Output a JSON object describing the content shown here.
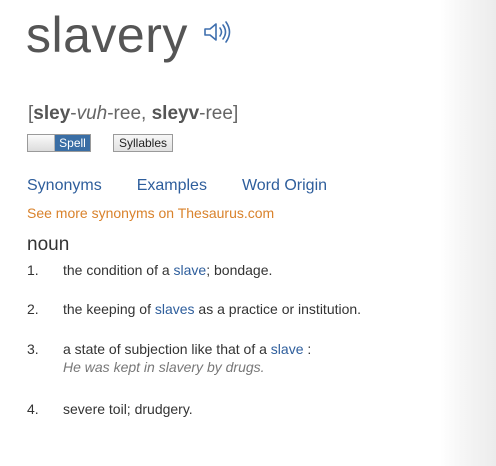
{
  "entry": {
    "headword": "slavery",
    "audio_icon": "speaker-icon",
    "pronunciation": {
      "open_bracket": "[",
      "p1_bold": "sley",
      "p1_dash": "-",
      "p1_italic": "vuh",
      "p1_rest": "-ree, ",
      "p2_bold": "sleyv",
      "p2_rest": "-ree",
      "close_bracket": "]"
    }
  },
  "controls": {
    "spell_label": "Spell",
    "syllables_label": "Syllables"
  },
  "links": {
    "synonyms": "Synonyms",
    "examples": "Examples",
    "word_origin": "Word Origin",
    "thesaurus": "See more synonyms on Thesaurus.com"
  },
  "part_of_speech": "noun",
  "definitions": [
    {
      "number": "1.",
      "before": "the condition of a ",
      "link": "slave",
      "after": "; bondage."
    },
    {
      "number": "2.",
      "before": "the keeping of ",
      "link": "slaves",
      "after": " as a practice or institution."
    },
    {
      "number": "3.",
      "before": "a state of subjection like that of a ",
      "link": "slave",
      "after": " :",
      "example": "He was kept in slavery by drugs."
    },
    {
      "number": "4.",
      "text": "severe toil; drudgery."
    }
  ],
  "colors": {
    "link": "#2e5e9c",
    "thesaurus_link": "#d9822b",
    "spell_active": "#3a6ea5"
  }
}
